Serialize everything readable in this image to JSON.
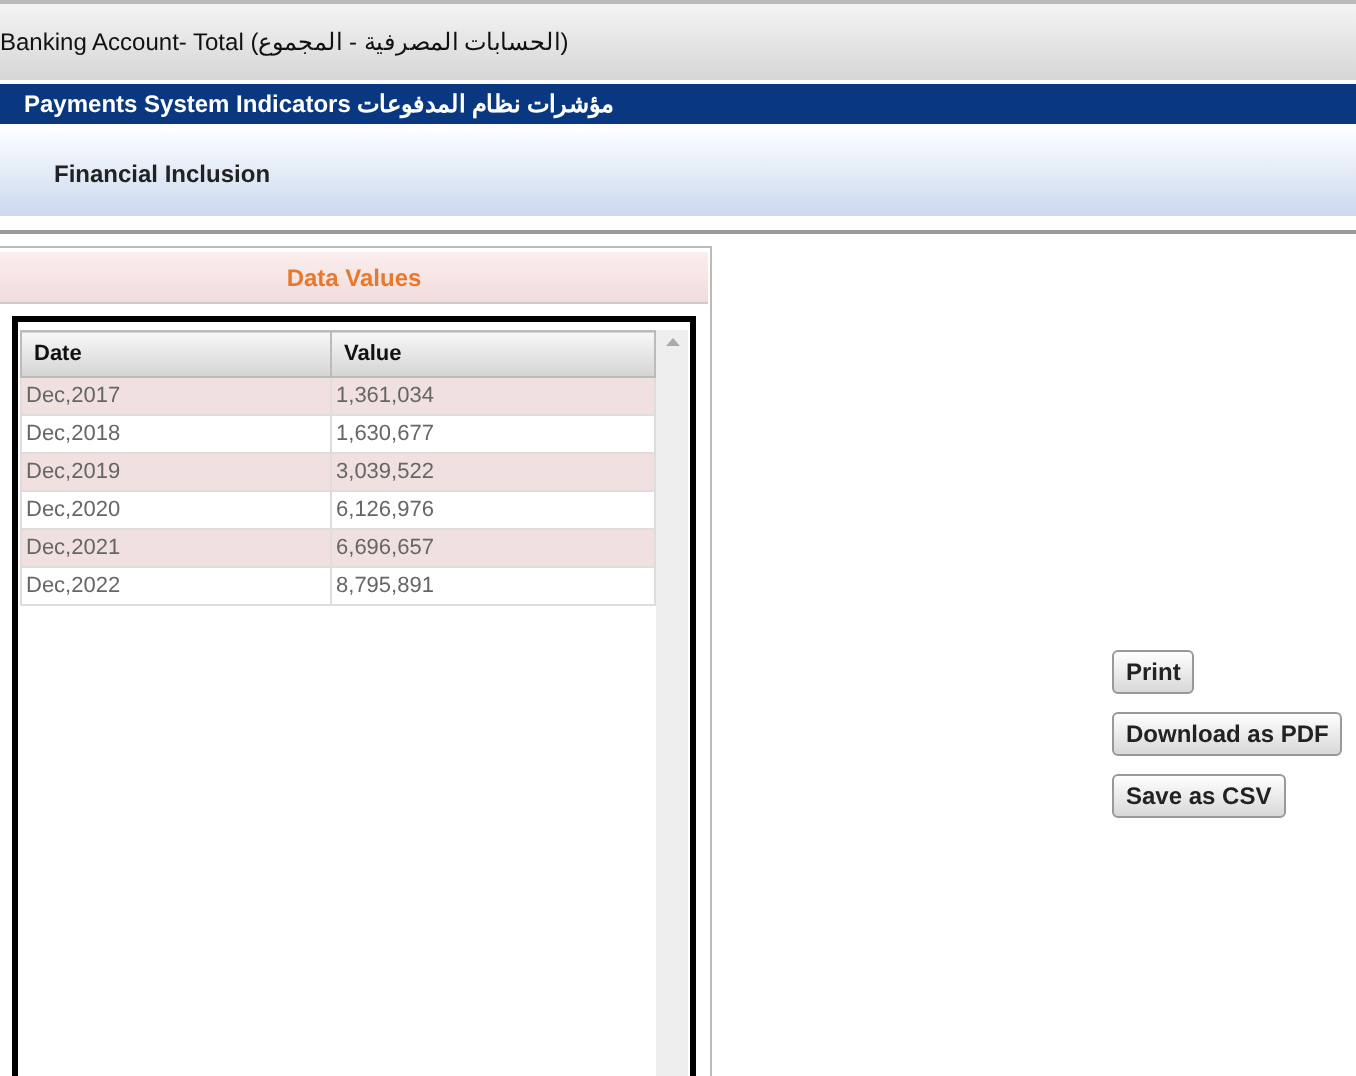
{
  "header": {
    "title": "Banking Account- Total (الحسابات المصرفية - المجموع)"
  },
  "section_bar": {
    "title": "Payments System Indicators مؤشرات نظام المدفوعات"
  },
  "subsection": {
    "title": "Financial Inclusion"
  },
  "panel": {
    "title": "Data Values",
    "table": {
      "columns": [
        "Date",
        "Value"
      ],
      "rows": [
        [
          "Dec,2017",
          "1,361,034"
        ],
        [
          "Dec,2018",
          "1,630,677"
        ],
        [
          "Dec,2019",
          "3,039,522"
        ],
        [
          "Dec,2020",
          "6,126,976"
        ],
        [
          "Dec,2021",
          "6,696,657"
        ],
        [
          "Dec,2022",
          "8,795,891"
        ]
      ]
    }
  },
  "buttons": [
    "Print",
    "Download as PDF",
    "Save as CSV"
  ]
}
